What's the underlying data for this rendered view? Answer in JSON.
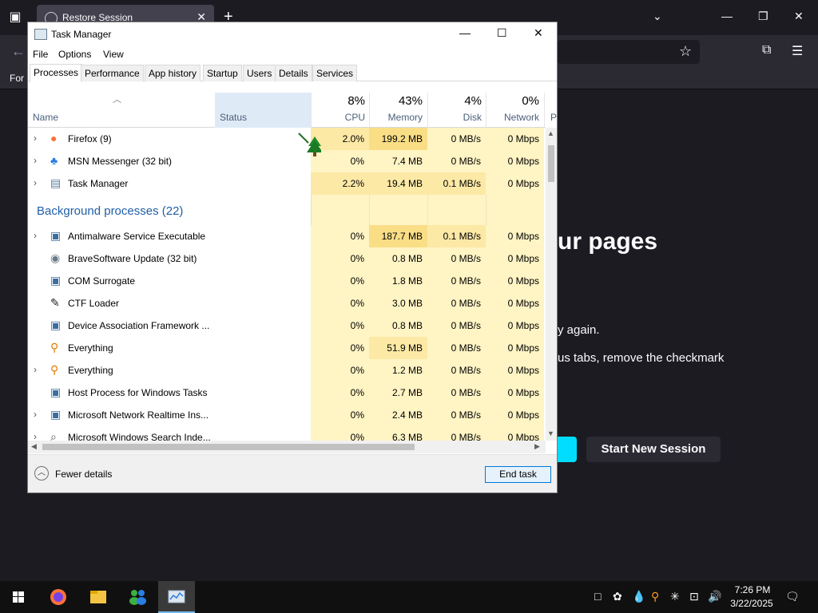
{
  "browser": {
    "tab_title": "Restore Session",
    "tab_close": "✕",
    "new_tab": "+",
    "bookmark_text": "For",
    "heading": "ur pages",
    "line1": "y again.",
    "line2": "us tabs, remove the checkmark",
    "new_session_label": "Start New Session"
  },
  "task_manager": {
    "title": "Task Manager",
    "menu": [
      "File",
      "Options",
      "View"
    ],
    "tabs": [
      "Processes",
      "Performance",
      "App history",
      "Startup",
      "Users",
      "Details",
      "Services"
    ],
    "active_tab": "Processes",
    "columns": {
      "name": "Name",
      "status": "Status",
      "cpu": {
        "pct": "8%",
        "label": "CPU"
      },
      "memory": {
        "pct": "43%",
        "label": "Memory"
      },
      "disk": {
        "pct": "4%",
        "label": "Disk"
      },
      "network": {
        "pct": "0%",
        "label": "Network"
      },
      "extra": "P"
    },
    "apps": [
      {
        "name": "Firefox (9)",
        "icon": "firefox-icon",
        "expandable": true,
        "cpu": "2.0%",
        "memory": "199.2 MB",
        "disk": "0 MB/s",
        "network": "0 Mbps"
      },
      {
        "name": "MSN Messenger (32 bit)",
        "icon": "msn-messenger-icon",
        "expandable": true,
        "cpu": "0%",
        "memory": "7.4 MB",
        "disk": "0 MB/s",
        "network": "0 Mbps"
      },
      {
        "name": "Task Manager",
        "icon": "task-manager-icon",
        "expandable": true,
        "cpu": "2.2%",
        "memory": "19.4 MB",
        "disk": "0.1 MB/s",
        "network": "0 Mbps"
      }
    ],
    "background_group_title": "Background processes (22)",
    "background": [
      {
        "name": "Antimalware Service Executable",
        "icon": "service-window-icon",
        "expandable": true,
        "cpu": "0%",
        "memory": "187.7 MB",
        "disk": "0.1 MB/s",
        "network": "0 Mbps"
      },
      {
        "name": "BraveSoftware Update (32 bit)",
        "icon": "updater-icon",
        "expandable": false,
        "cpu": "0%",
        "memory": "0.8 MB",
        "disk": "0 MB/s",
        "network": "0 Mbps"
      },
      {
        "name": "COM Surrogate",
        "icon": "service-window-icon",
        "expandable": false,
        "cpu": "0%",
        "memory": "1.8 MB",
        "disk": "0 MB/s",
        "network": "0 Mbps"
      },
      {
        "name": "CTF Loader",
        "icon": "pen-icon",
        "expandable": false,
        "cpu": "0%",
        "memory": "3.0 MB",
        "disk": "0 MB/s",
        "network": "0 Mbps"
      },
      {
        "name": "Device Association Framework ...",
        "icon": "service-window-icon",
        "expandable": false,
        "cpu": "0%",
        "memory": "0.8 MB",
        "disk": "0 MB/s",
        "network": "0 Mbps"
      },
      {
        "name": "Everything",
        "icon": "magnifier-icon",
        "expandable": false,
        "cpu": "0%",
        "memory": "51.9 MB",
        "disk": "0 MB/s",
        "network": "0 Mbps"
      },
      {
        "name": "Everything",
        "icon": "magnifier-icon",
        "expandable": true,
        "cpu": "0%",
        "memory": "1.2 MB",
        "disk": "0 MB/s",
        "network": "0 Mbps"
      },
      {
        "name": "Host Process for Windows Tasks",
        "icon": "service-window-icon",
        "expandable": false,
        "cpu": "0%",
        "memory": "2.7 MB",
        "disk": "0 MB/s",
        "network": "0 Mbps"
      },
      {
        "name": "Microsoft Network Realtime Ins...",
        "icon": "service-window-icon",
        "expandable": true,
        "cpu": "0%",
        "memory": "2.4 MB",
        "disk": "0 MB/s",
        "network": "0 Mbps"
      },
      {
        "name": "Microsoft Windows Search Inde...",
        "icon": "search-indexer-icon",
        "expandable": true,
        "cpu": "0%",
        "memory": "6.3 MB",
        "disk": "0 MB/s",
        "network": "0 Mbps"
      }
    ],
    "fewer_details_label": "Fewer details",
    "end_task_label": "End task"
  },
  "taskbar": {
    "items": [
      "start-icon",
      "firefox-icon",
      "file-explorer-icon",
      "msn-messenger-icon",
      "task-manager-icon"
    ],
    "active_item": "task-manager-icon",
    "time": "7:26 PM",
    "date": "3/22/2025"
  },
  "colors": {
    "heat_low": "#fff4c4",
    "heat_mid": "#fce9a6",
    "heat_high": "#f9de86",
    "status_header": "#dfeaf7",
    "accent": "#0078d7",
    "ff_cyan": "#00ddff"
  }
}
